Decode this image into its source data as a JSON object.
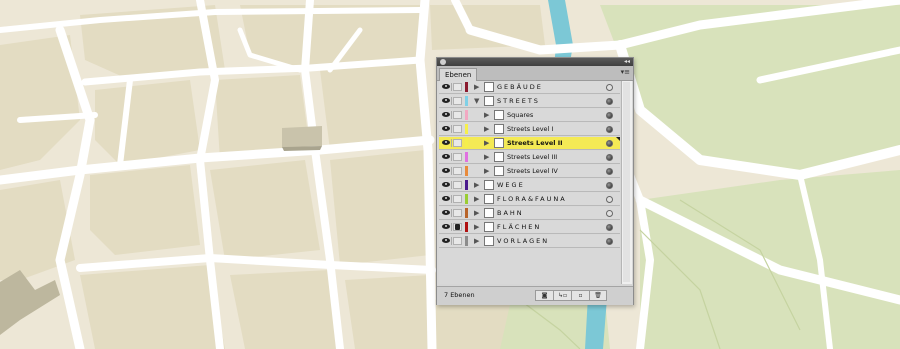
{
  "panel": {
    "tab_label": "Ebenen",
    "collapse_glyph": "◂◂",
    "menu_glyph": "▾≡",
    "layer_count": "7 Ebenen"
  },
  "layers": [
    {
      "name": "GEBÄUDE",
      "color": "#8b1a2e",
      "top": true,
      "expanded": false,
      "locked": false,
      "selected": false,
      "target_filled": false
    },
    {
      "name": "STREETS",
      "color": "#7fd0e6",
      "top": true,
      "expanded": true,
      "locked": false,
      "selected": false,
      "target_filled": true
    },
    {
      "name": "Squares",
      "color": "#f2a8c2",
      "top": false,
      "expanded": false,
      "locked": false,
      "selected": false,
      "target_filled": true
    },
    {
      "name": "Streets Level I",
      "color": "#f5ef4c",
      "top": false,
      "expanded": false,
      "locked": false,
      "selected": false,
      "target_filled": true
    },
    {
      "name": "Streets Level II",
      "color": "#f5ef4c",
      "top": false,
      "expanded": false,
      "locked": false,
      "selected": true,
      "target_filled": true
    },
    {
      "name": "Streets Level III",
      "color": "#e070e0",
      "top": false,
      "expanded": false,
      "locked": false,
      "selected": false,
      "target_filled": true
    },
    {
      "name": "Streets Level IV",
      "color": "#e88a3a",
      "top": false,
      "expanded": false,
      "locked": false,
      "selected": false,
      "target_filled": true
    },
    {
      "name": "WEGE",
      "color": "#4a1a8c",
      "top": true,
      "expanded": false,
      "locked": false,
      "selected": false,
      "target_filled": true
    },
    {
      "name": "FLORA&FAUNA",
      "color": "#9acd32",
      "top": true,
      "expanded": false,
      "locked": false,
      "selected": false,
      "target_filled": false
    },
    {
      "name": "BAHN",
      "color": "#b8642a",
      "top": true,
      "expanded": false,
      "locked": false,
      "selected": false,
      "target_filled": false
    },
    {
      "name": "FLÄCHEN",
      "color": "#b01010",
      "top": true,
      "expanded": false,
      "locked": true,
      "selected": false,
      "target_filled": true
    },
    {
      "name": "VORLAGEN",
      "color": "#8c8c8c",
      "top": true,
      "expanded": false,
      "locked": false,
      "selected": false,
      "target_filled": true
    }
  ],
  "bottom_buttons": [
    {
      "name": "make-clipping-mask-button",
      "glyph": "◙"
    },
    {
      "name": "new-sublayer-button",
      "glyph": "↳▫"
    },
    {
      "name": "new-layer-button",
      "glyph": "▫"
    },
    {
      "name": "delete-layer-button",
      "glyph": "🗑"
    }
  ],
  "icons": {
    "visibility": "eye-icon",
    "lock": "lock-icon",
    "expand": "triangle-right-icon",
    "collapse": "triangle-down-icon",
    "target": "target-circle-icon"
  },
  "colors": {
    "map_bg": "#eae4d3",
    "block": "#e2dcc1",
    "road": "#ffffff",
    "park": "#d8e2bb",
    "river": "#7cc8d6",
    "building": "#c9c3ab",
    "selected_row": "#f4ea55"
  }
}
